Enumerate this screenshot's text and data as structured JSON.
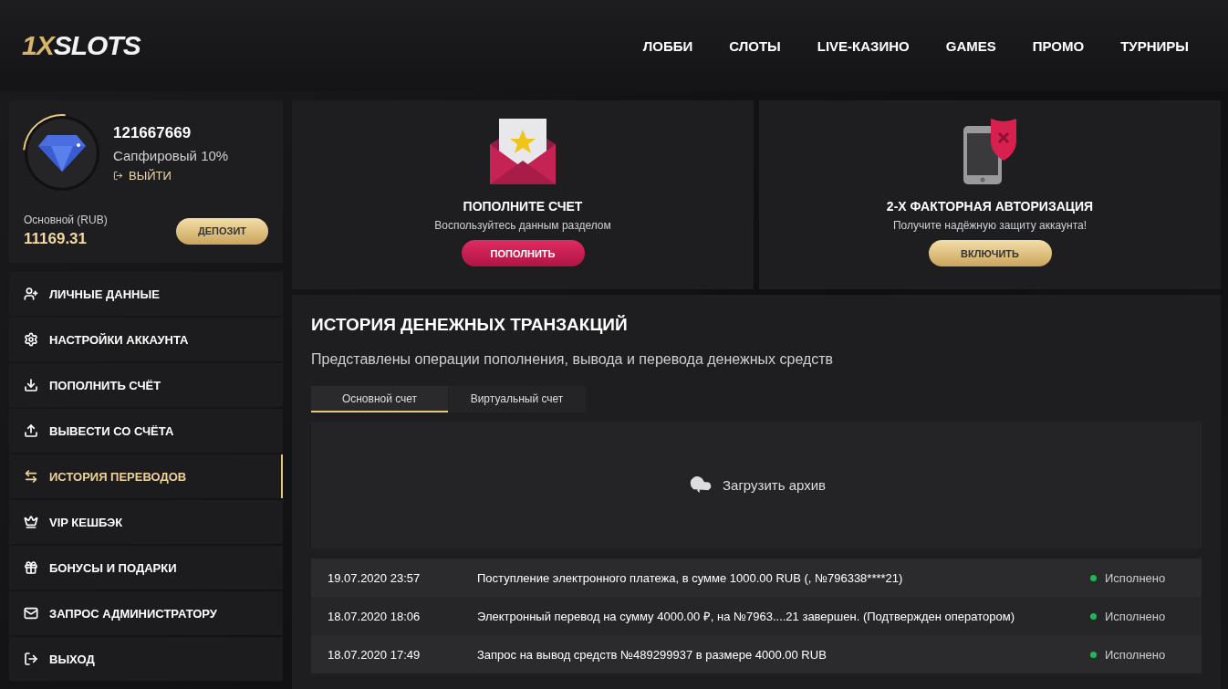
{
  "logo": {
    "accent": "1X",
    "text": "SLOTS"
  },
  "nav": [
    {
      "label": "ЛОББИ"
    },
    {
      "label": "СЛОТЫ"
    },
    {
      "label": "LIVE-КАЗИНО"
    },
    {
      "label": "GAMES"
    },
    {
      "label": "ПРОМО"
    },
    {
      "label": "ТУРНИРЫ"
    }
  ],
  "profile": {
    "id": "121667669",
    "tier": "Сапфировый 10%",
    "logout": "ВЫЙТИ",
    "balance_label": "Основной (RUB)",
    "balance": "11169.31",
    "deposit": "ДЕПОЗИТ"
  },
  "menu": [
    {
      "kind": "user",
      "label": "ЛИЧНЫЕ ДАННЫЕ",
      "selected": false
    },
    {
      "kind": "settings",
      "label": "НАСТРОЙКИ АККАУНТА",
      "selected": false
    },
    {
      "kind": "download",
      "label": "ПОПОЛНИТЬ СЧЁТ",
      "selected": false
    },
    {
      "kind": "upload",
      "label": "ВЫВЕСТИ СО СЧЁТА",
      "selected": false
    },
    {
      "kind": "transfer",
      "label": "ИСТОРИЯ ПЕРЕВОДОВ",
      "selected": true
    },
    {
      "kind": "crown",
      "label": "VIP КЕШБЭК",
      "selected": false
    },
    {
      "kind": "gift",
      "label": "БОНУСЫ И ПОДАРКИ",
      "selected": false
    },
    {
      "kind": "mail",
      "label": "ЗАПРОС АДМИНИСТРАТОРУ",
      "selected": false
    },
    {
      "kind": "exit",
      "label": "ВЫХОД",
      "selected": false
    }
  ],
  "promos": [
    {
      "kind": "envelope",
      "title": "ПОПОЛНИТЕ СЧЕТ",
      "subtitle": "Воспользуйтесь данным разделом",
      "button": "ПОПОЛНИТЬ"
    },
    {
      "kind": "phone",
      "title": "2-Х ФАКТОРНАЯ АВТОРИЗАЦИЯ",
      "subtitle": "Получите надёжную защиту аккаунта!",
      "button": "ВКЛЮЧИТЬ"
    }
  ],
  "history": {
    "title": "ИСТОРИЯ ДЕНЕЖНЫХ ТРАНЗАКЦИЙ",
    "subtitle": "Представлены операции пополнения, вывода и перевода денежных средств",
    "tabs": [
      {
        "label": "Основной счет",
        "selected": true
      },
      {
        "label": "Виртуальный счет",
        "selected": false
      }
    ],
    "archive": "Загрузить архив",
    "rows": [
      {
        "date": "19.07.2020 23:57",
        "description": "Поступление электронного платежа, в сумме 1000.00 RUB (, №796338****21)",
        "status": "Исполнено",
        "color": "#1db954"
      },
      {
        "date": "18.07.2020 18:06",
        "description": "Электронный перевод на сумму 4000.00 ₽, на №7963....21 завершен. (Подтвержден оператором)",
        "status": "Исполнено",
        "color": "#1db954"
      },
      {
        "date": "18.07.2020 17:49",
        "description": "Запрос на вывод средств №489299937 в размере 4000.00 RUB",
        "status": "Исполнено",
        "color": "#1db954"
      }
    ]
  }
}
